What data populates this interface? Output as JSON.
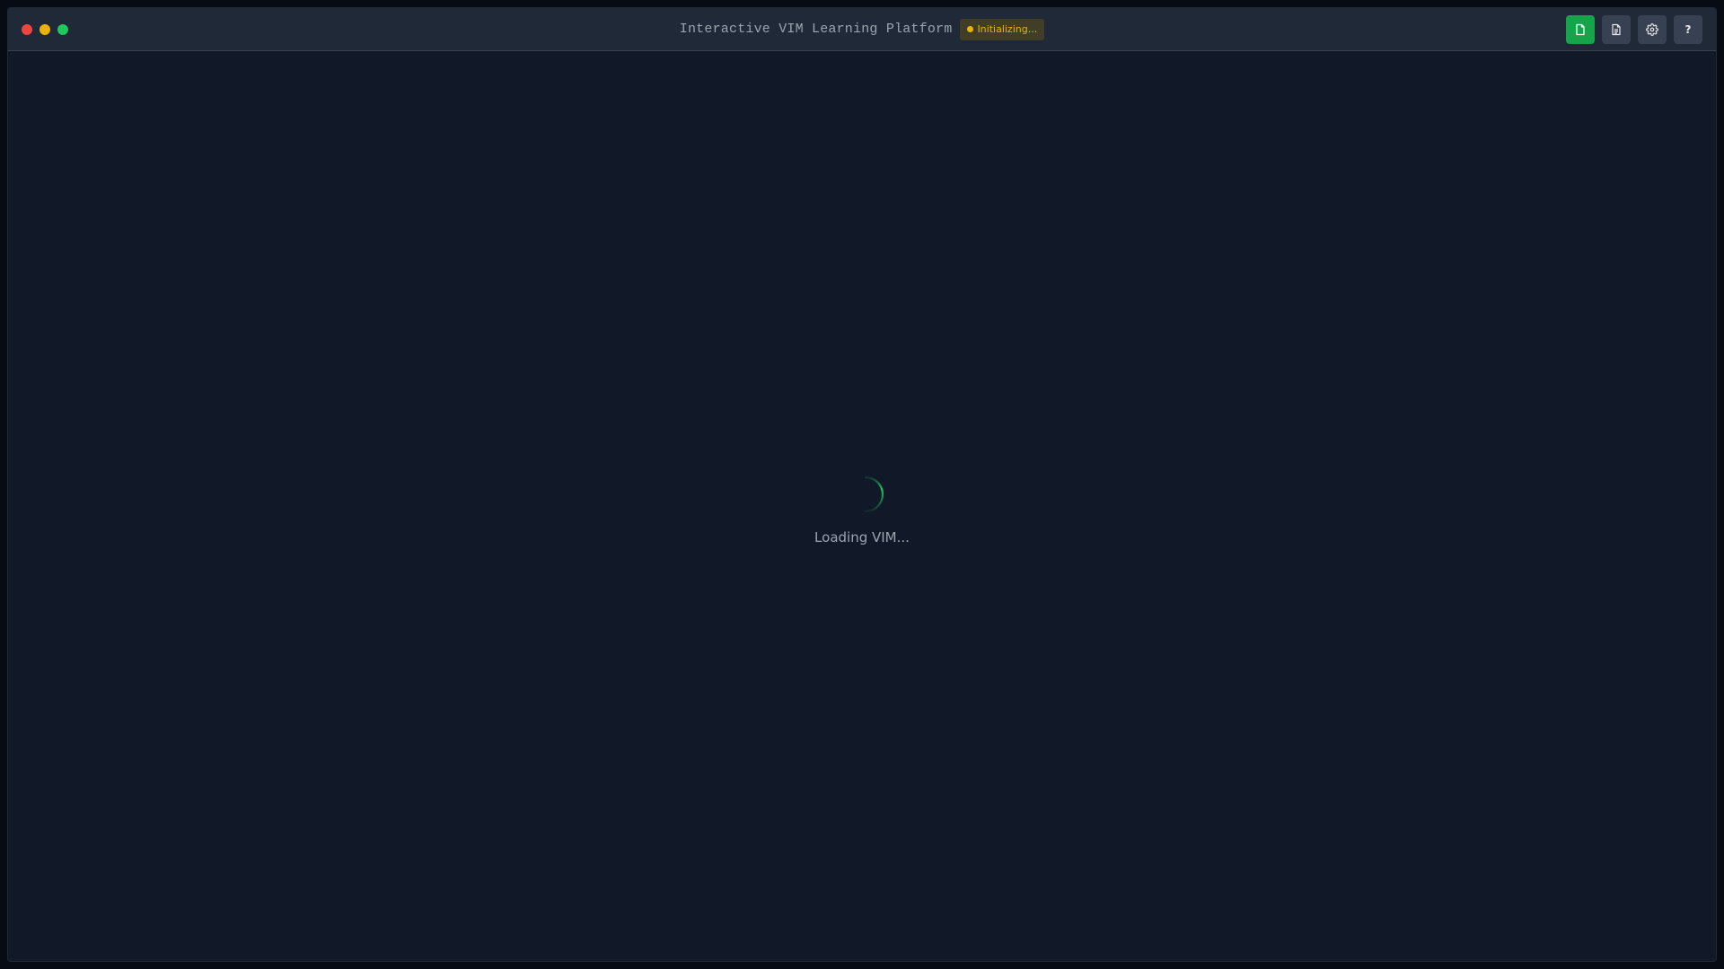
{
  "window": {
    "title": "Interactive VIM Learning Platform",
    "status_badge": {
      "label": "Initializing...",
      "dot_color": "#eab308",
      "text_color": "#eab308"
    }
  },
  "traffic_lights": {
    "close_color": "#ef4444",
    "minimize_color": "#eab308",
    "maximize_color": "#22c55e"
  },
  "toolbar": {
    "buttons": [
      {
        "icon": "new-file-icon",
        "active": true
      },
      {
        "icon": "document-icon",
        "active": false
      },
      {
        "icon": "gear-icon",
        "active": false
      },
      {
        "icon": "help-icon",
        "label": "?",
        "active": false
      }
    ],
    "accent_color": "#16a34a"
  },
  "loading": {
    "text": "Loading VIM...",
    "spinner_color": "#22c55e"
  }
}
